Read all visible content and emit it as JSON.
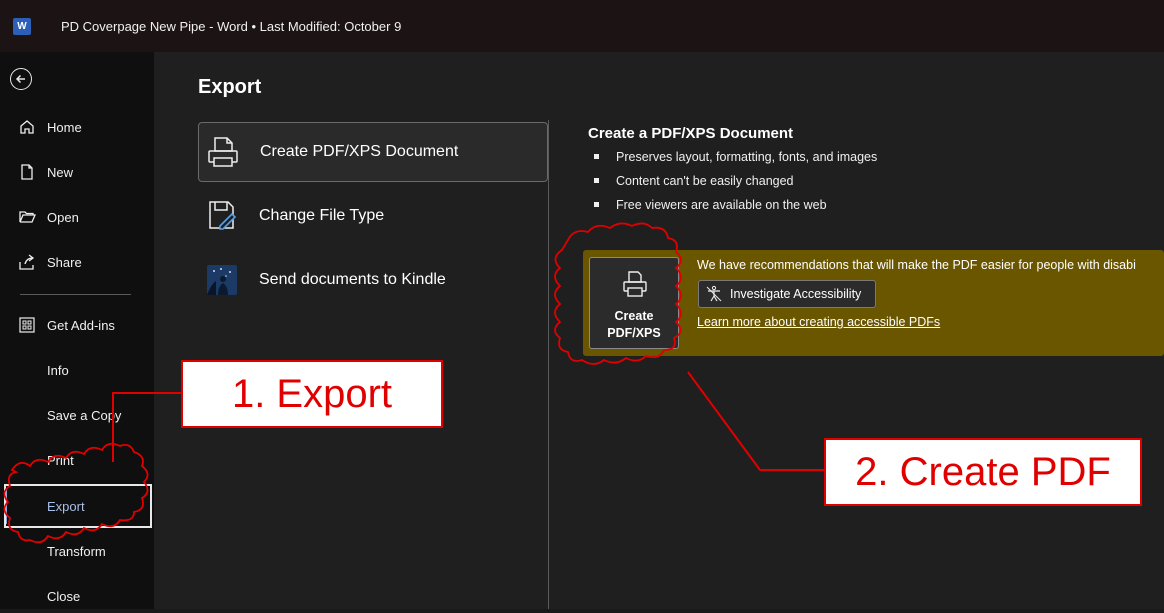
{
  "titlebar": {
    "app_logo": "W",
    "title": "PD Coverpage New Pipe  -  Word  •  Last Modified: October 9"
  },
  "sidebar": {
    "items": [
      {
        "label": "Home",
        "icon": "home-icon"
      },
      {
        "label": "New",
        "icon": "new-document-icon"
      },
      {
        "label": "Open",
        "icon": "folder-open-icon"
      },
      {
        "label": "Share",
        "icon": "share-icon"
      },
      {
        "label": "Get Add-ins",
        "icon": "add-ins-grid-icon"
      },
      {
        "label": "Info"
      },
      {
        "label": "Save a Copy"
      },
      {
        "label": "Print"
      },
      {
        "label": "Export",
        "selected": true
      },
      {
        "label": "Transform"
      },
      {
        "label": "Close"
      }
    ]
  },
  "main": {
    "title": "Export",
    "options": [
      {
        "label": "Create PDF/XPS Document",
        "icon": "pdf-document-icon",
        "selected": true
      },
      {
        "label": "Change File Type",
        "icon": "change-file-type-icon"
      },
      {
        "label": "Send documents to Kindle",
        "icon": "kindle-icon"
      }
    ],
    "detail": {
      "title": "Create a PDF/XPS Document",
      "bullets": [
        "Preserves layout, formatting, fonts, and images",
        "Content can't be easily changed",
        "Free viewers are available on the web"
      ],
      "create_button": {
        "line1": "Create",
        "line2": "PDF/XPS"
      },
      "banner": {
        "text": "We have recommendations that will make the PDF easier for people with disabi",
        "investigate_label": "Investigate Accessibility",
        "learn_more": "Learn more about creating accessible PDFs"
      }
    }
  },
  "annotations": {
    "callout_1": "1. Export",
    "callout_2": "2. Create PDF"
  },
  "colors": {
    "banner": "#6b5600",
    "annotation_red": "#e00000",
    "sidebar_bg": "#0f0f0f",
    "main_bg": "#1f1f1f"
  }
}
